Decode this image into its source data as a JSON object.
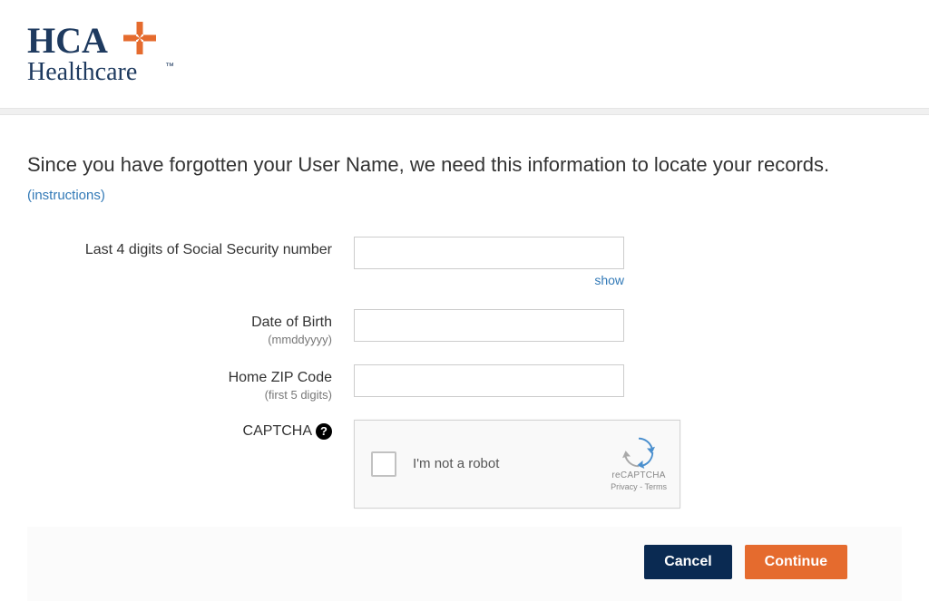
{
  "logo": {
    "line1": "HCA",
    "line2": "Healthcare",
    "accent_color": "#e56b2e",
    "text_color": "#1e3a5f"
  },
  "heading": {
    "text": "Since you have forgotten your User Name, we need this information to locate your records.",
    "instructions_link": "(instructions)"
  },
  "form": {
    "ssn": {
      "label": "Last 4 digits of Social Security number",
      "value": "",
      "show_link": "show"
    },
    "dob": {
      "label": "Date of Birth",
      "hint": "(mmddyyyy)",
      "value": ""
    },
    "zip": {
      "label": "Home ZIP Code",
      "hint": "(first 5 digits)",
      "value": ""
    },
    "captcha": {
      "label": "CAPTCHA",
      "help_icon": "?",
      "not_robot_text": "I'm not a robot",
      "brand": "reCAPTCHA",
      "links": "Privacy - Terms"
    }
  },
  "buttons": {
    "cancel": "Cancel",
    "continue": "Continue"
  }
}
